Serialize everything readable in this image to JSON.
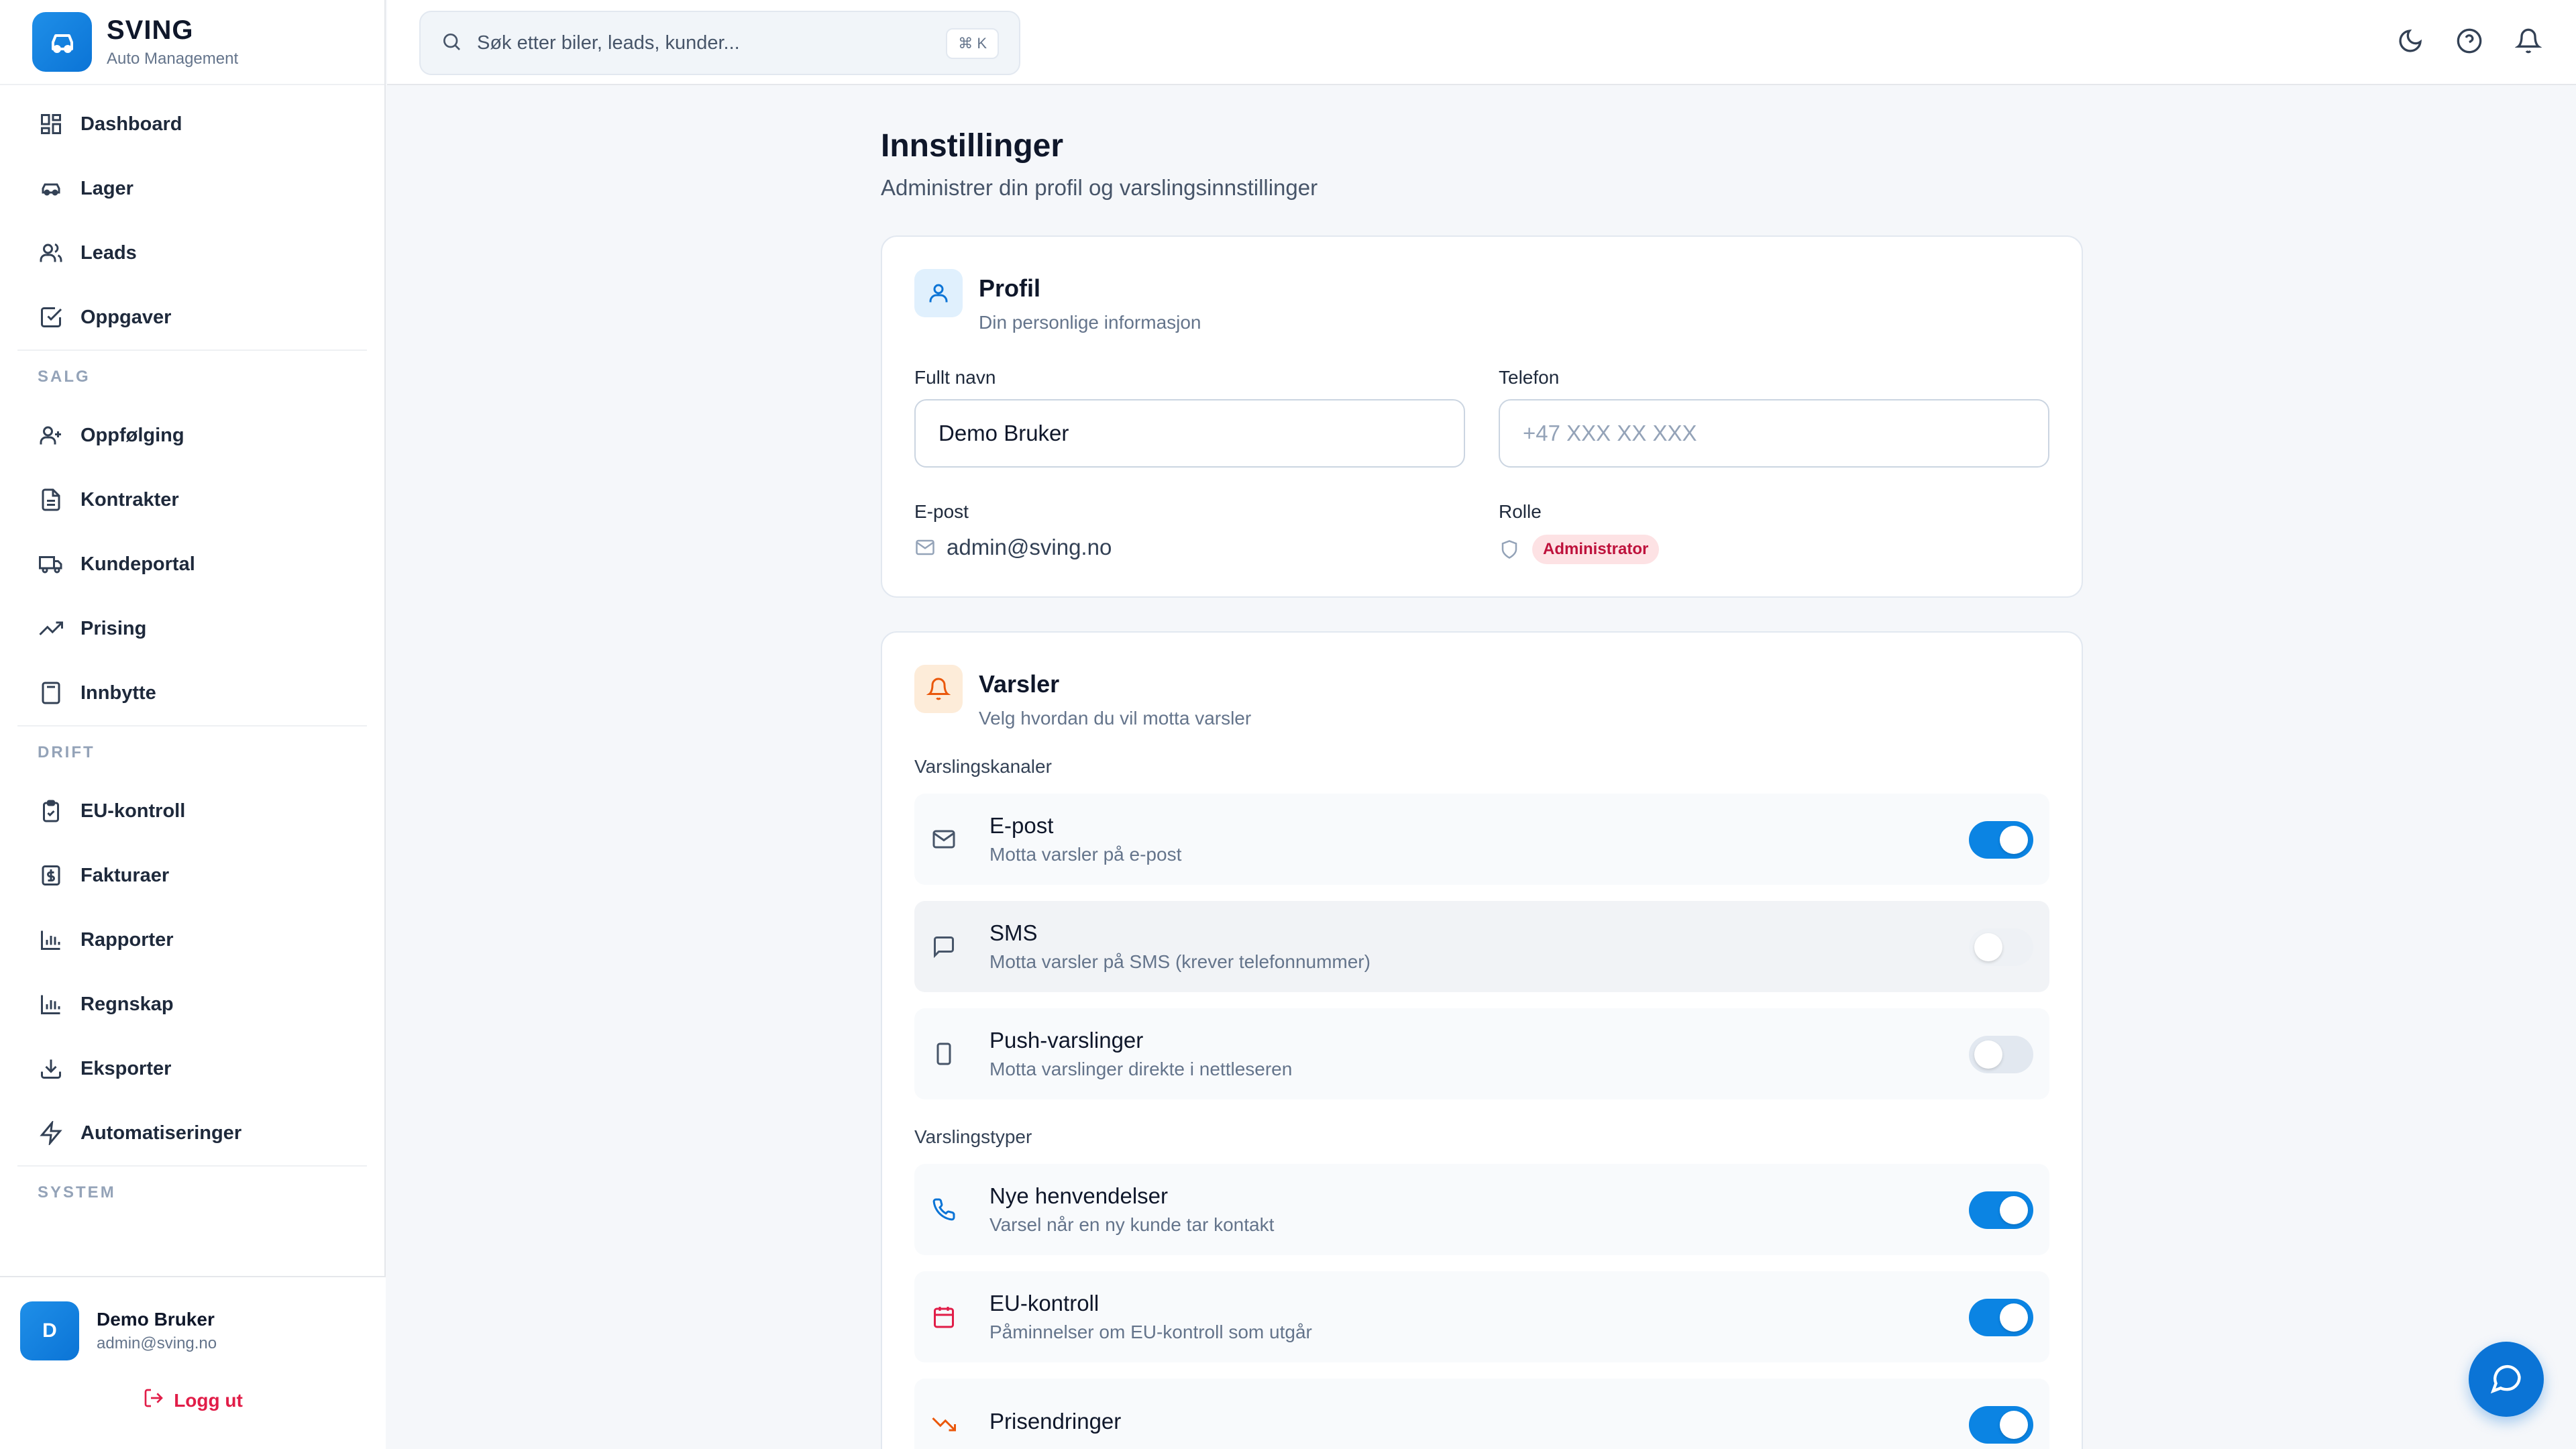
{
  "brand": {
    "name": "SVING",
    "subtitle": "Auto Management"
  },
  "nav": {
    "primary": [
      {
        "label": "Dashboard",
        "icon": "grid-icon"
      },
      {
        "label": "Lager",
        "icon": "car-icon"
      },
      {
        "label": "Leads",
        "icon": "users-icon"
      },
      {
        "label": "Oppgaver",
        "icon": "check-square-icon"
      }
    ],
    "salg_title": "SALG",
    "salg": [
      {
        "label": "Oppfølging",
        "icon": "user-plus-icon"
      },
      {
        "label": "Kontrakter",
        "icon": "file-icon"
      },
      {
        "label": "Kundeportal",
        "icon": "truck-icon"
      },
      {
        "label": "Prising",
        "icon": "trending-up-icon"
      },
      {
        "label": "Innbytte",
        "icon": "calculator-icon"
      }
    ],
    "drift_title": "DRIFT",
    "drift": [
      {
        "label": "EU-kontroll",
        "icon": "clipboard-check-icon"
      },
      {
        "label": "Fakturaer",
        "icon": "dollar-icon"
      },
      {
        "label": "Rapporter",
        "icon": "bar-chart-icon"
      },
      {
        "label": "Regnskap",
        "icon": "bar-chart-icon"
      },
      {
        "label": "Eksporter",
        "icon": "download-icon"
      },
      {
        "label": "Automatiseringer",
        "icon": "zap-icon"
      }
    ],
    "system_title": "SYSTEM"
  },
  "user": {
    "initial": "D",
    "name": "Demo Bruker",
    "email": "admin@sving.no",
    "logout": "Logg ut"
  },
  "search": {
    "placeholder": "Søk etter biler, leads, kunder...",
    "shortcut": "⌘ K"
  },
  "page": {
    "title": "Innstillinger",
    "subtitle": "Administrer din profil og varslingsinnstillinger"
  },
  "profile": {
    "title": "Profil",
    "desc": "Din personlige informasjon",
    "name_label": "Fullt navn",
    "name_value": "Demo Bruker",
    "phone_label": "Telefon",
    "phone_placeholder": "+47 XXX XX XXX",
    "email_label": "E-post",
    "email_value": "admin@sving.no",
    "role_label": "Rolle",
    "role_value": "Administrator"
  },
  "alerts": {
    "title": "Varsler",
    "desc": "Velg hvordan du vil motta varsler",
    "channels_label": "Varslingskanaler",
    "channels": [
      {
        "title": "E-post",
        "desc": "Motta varsler på e-post",
        "on": true
      },
      {
        "title": "SMS",
        "desc": "Motta varsler på SMS (krever telefonnummer)",
        "on": false
      },
      {
        "title": "Push-varslinger",
        "desc": "Motta varslinger direkte i nettleseren",
        "on": false
      }
    ],
    "types_label": "Varslingstyper",
    "types": [
      {
        "title": "Nye henvendelser",
        "desc": "Varsel når en ny kunde tar kontakt",
        "on": true
      },
      {
        "title": "EU-kontroll",
        "desc": "Påminnelser om EU-kontroll som utgår",
        "on": true
      },
      {
        "title": "Prisendringer",
        "desc": "",
        "on": true
      }
    ]
  },
  "colors": {
    "accent": "#0b84e3",
    "danger": "#e11d48",
    "warning": "#ea580c"
  }
}
